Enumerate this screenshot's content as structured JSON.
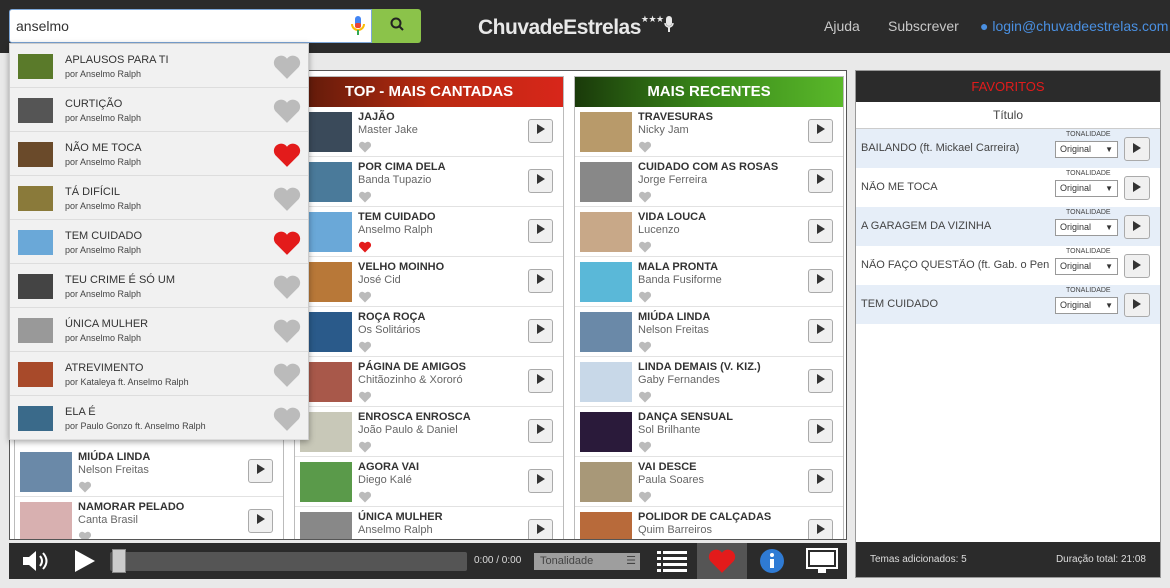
{
  "search": {
    "value": "anselmo"
  },
  "logo": {
    "text": "ChuvadeEstrelas",
    "stars": "★★★"
  },
  "nav": {
    "help": "Ajuda",
    "subscribe": "Subscrever",
    "login": "login@chuvadeestrelas.com"
  },
  "columns": [
    {
      "title": "",
      "color": "#222",
      "rows": [
        {
          "title": "MIÚDA LINDA",
          "artist": "Nelson Freitas",
          "fav": false,
          "thumb": "#6a89a8"
        },
        {
          "title": "NAMORAR PELADO",
          "artist": "Canta Brasil",
          "fav": false,
          "thumb": "#d8b0b0"
        }
      ]
    },
    {
      "title": "TOP - MAIS CANTADAS",
      "color": "linear-gradient(90deg,#5a1a0a,#b82a10,#d8261a)",
      "rows": [
        {
          "title": "JAJÃO",
          "artist": "Master Jake",
          "fav": false,
          "thumb": "#3a4a5a"
        },
        {
          "title": "POR CIMA DELA",
          "artist": "Banda Tupazio",
          "fav": false,
          "thumb": "#4a7a9a"
        },
        {
          "title": "TEM CUIDADO",
          "artist": "Anselmo Ralph",
          "fav": true,
          "thumb": "#6aa8d8"
        },
        {
          "title": "VELHO MOINHO",
          "artist": "José Cid",
          "fav": false,
          "thumb": "#b87838"
        },
        {
          "title": "ROÇA ROÇA",
          "artist": "Os Solitários",
          "fav": false,
          "thumb": "#2a5a8a"
        },
        {
          "title": "PÁGINA DE AMIGOS",
          "artist": "Chitãozinho & Xororó",
          "fav": false,
          "thumb": "#a8584a"
        },
        {
          "title": "ENROSCA ENROSCA",
          "artist": "João Paulo & Daniel",
          "fav": false,
          "thumb": "#c8c8b8"
        },
        {
          "title": "AGORA VAI",
          "artist": "Diego Kalé",
          "fav": false,
          "thumb": "#5a9a4a"
        },
        {
          "title": "ÚNICA MULHER",
          "artist": "Anselmo Ralph",
          "fav": false,
          "thumb": "#888"
        }
      ]
    },
    {
      "title": "MAIS RECENTES",
      "color": "linear-gradient(90deg,#1a3a0a,#3a8a1a,#5ab82a)",
      "rows": [
        {
          "title": "TRAVESURAS",
          "artist": "Nicky Jam",
          "fav": false,
          "thumb": "#b89a6a"
        },
        {
          "title": "CUIDADO COM AS ROSAS",
          "artist": "Jorge Ferreira",
          "fav": false,
          "thumb": "#888"
        },
        {
          "title": "VIDA LOUCA",
          "artist": "Lucenzo",
          "fav": false,
          "thumb": "#c8a888"
        },
        {
          "title": "MALA PRONTA",
          "artist": "Banda Fusiforme",
          "fav": false,
          "thumb": "#5ab8d8"
        },
        {
          "title": "MIÚDA LINDA",
          "artist": "Nelson Freitas",
          "fav": false,
          "thumb": "#6a89a8"
        },
        {
          "title": "LINDA DEMAIS (v. kiz.)",
          "artist": "Gaby Fernandes",
          "fav": false,
          "thumb": "#c8d8e8"
        },
        {
          "title": "DANÇA SENSUAL",
          "artist": "Sol Brilhante",
          "fav": false,
          "thumb": "#2a1a3a"
        },
        {
          "title": "VAI DESCE",
          "artist": "Paula Soares",
          "fav": false,
          "thumb": "#a89878"
        },
        {
          "title": "POLIDOR DE CALÇADAS",
          "artist": "Quim Barreiros",
          "fav": false,
          "thumb": "#b86a3a"
        }
      ]
    }
  ],
  "favorites": {
    "title": "FAVORITOS",
    "column": "Título",
    "tone_label": "TONALIDADE",
    "tone_value": "Original",
    "rows": [
      "BAILANDO (ft. Mickael Carreira)",
      "NÃO ME TOCA",
      "A GARAGEM DA VIZINHA",
      "NÃO FAÇO QUESTÃO (ft. Gab. o Pen...",
      "TEM CUIDADO"
    ],
    "added": "Temas adicionados: 5",
    "duration": "Duração total: 21:08"
  },
  "player": {
    "time": "0:00 / 0:00",
    "tone": "Tonalidade"
  },
  "dropdown": [
    {
      "title": "APLAUSOS PARA TI",
      "artist": "por Anselmo Ralph",
      "fav": false,
      "thumb": "#5a7a2a"
    },
    {
      "title": "CURTIÇÃO",
      "artist": "por Anselmo Ralph",
      "fav": false,
      "thumb": "#555"
    },
    {
      "title": "NÃO ME TOCA",
      "artist": "por Anselmo Ralph",
      "fav": true,
      "thumb": "#6a4a2a"
    },
    {
      "title": "TÁ DIFÍCIL",
      "artist": "por Anselmo Ralph",
      "fav": false,
      "thumb": "#8a7a3a"
    },
    {
      "title": "TEM CUIDADO",
      "artist": "por Anselmo Ralph",
      "fav": true,
      "thumb": "#6aa8d8"
    },
    {
      "title": "TEU CRIME É SÓ UM",
      "artist": "por Anselmo Ralph",
      "fav": false,
      "thumb": "#444"
    },
    {
      "title": "ÚNICA MULHER",
      "artist": "por Anselmo Ralph",
      "fav": false,
      "thumb": "#999"
    },
    {
      "title": "ATREVIMENTO",
      "artist": "por Kataleya ft. Anselmo Ralph",
      "fav": false,
      "thumb": "#a84a2a"
    },
    {
      "title": "ELA É",
      "artist": "por Paulo Gonzo ft. Anselmo Ralph",
      "fav": false,
      "thumb": "#3a6a8a"
    }
  ]
}
